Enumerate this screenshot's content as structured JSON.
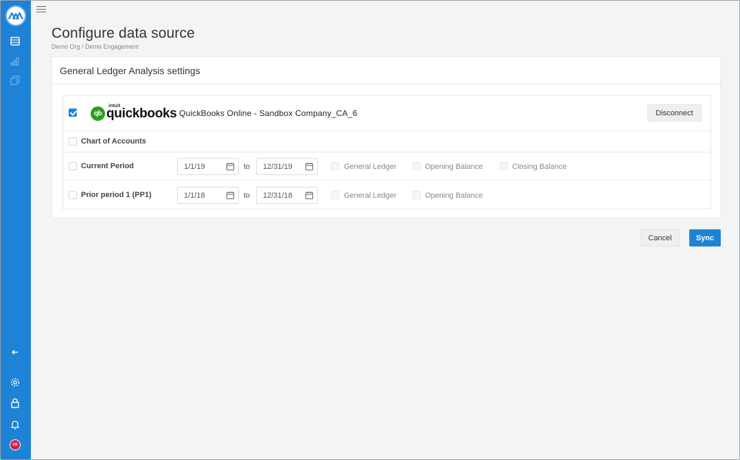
{
  "header": {
    "title": "Configure data source",
    "breadcrumb": "Demo Org / Demo Engagement"
  },
  "sidebar": {
    "items": [
      "logo-icon",
      "list-icon",
      "bar-chart-icon",
      "copy-icon",
      "collapse-arrow-icon",
      "gear-icon",
      "lock-icon",
      "bell-icon",
      "user-avatar"
    ],
    "avatar_initials": "CB"
  },
  "card": {
    "title": "General Ledger Analysis settings"
  },
  "connection": {
    "checked": true,
    "logo_prefix": "intuit",
    "logo_word": "quickbooks",
    "logo_badge": "qb",
    "name": "QuickBooks Online - Sandbox Company_CA_6",
    "disconnect_label": "Disconnect"
  },
  "chart_of_accounts": {
    "label": "Chart of Accounts"
  },
  "periods": [
    {
      "label": "Current Period",
      "from": "1/1/19",
      "to_word": "to",
      "to": "12/31/19",
      "options": [
        "General Ledger",
        "Opening Balance",
        "Closing Balance"
      ]
    },
    {
      "label": "Prior period 1 (PP1)",
      "from": "1/1/18",
      "to_word": "to",
      "to": "12/31/18",
      "options": [
        "General Ledger",
        "Opening Balance"
      ]
    }
  ],
  "actions": {
    "cancel_label": "Cancel",
    "sync_label": "Sync"
  },
  "colors": {
    "accent": "#1e83d6",
    "quickbooks_green": "#2ca01c"
  }
}
